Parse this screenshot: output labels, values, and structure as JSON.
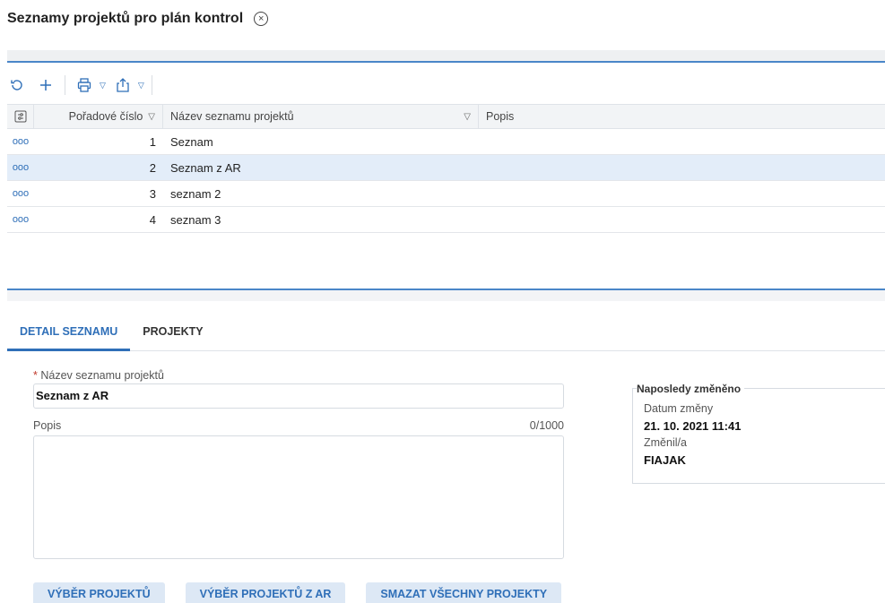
{
  "page": {
    "title": "Seznamy projektů pro plán kontrol",
    "close_icon": "×"
  },
  "grid": {
    "columns": {
      "order": "Pořadové číslo",
      "name": "Název seznamu projektů",
      "description": "Popis"
    },
    "rows": [
      {
        "order": "1",
        "name": "Seznam",
        "description": "",
        "selected": false
      },
      {
        "order": "2",
        "name": "Seznam z AR",
        "description": "",
        "selected": true
      },
      {
        "order": "3",
        "name": "seznam 2",
        "description": "",
        "selected": false
      },
      {
        "order": "4",
        "name": "seznam 3",
        "description": "",
        "selected": false
      }
    ],
    "row_menu_glyph": "ooo"
  },
  "tabs": [
    {
      "label": "DETAIL SEZNAMU",
      "active": true
    },
    {
      "label": "PROJEKTY",
      "active": false
    }
  ],
  "form": {
    "name_required_marker": "*",
    "name_label": "Název seznamu projektů",
    "name_value": "Seznam z AR",
    "description_label": "Popis",
    "description_counter": "0/1000",
    "description_value": ""
  },
  "buttons": {
    "select_projects": "VÝBĚR PROJEKTŮ",
    "select_projects_ar": "VÝBĚR PROJEKTŮ Z AR",
    "delete_all": "SMAZAT VŠECHNY PROJEKTY"
  },
  "last_changed": {
    "title": "Naposledy změněno",
    "date_label": "Datum změny",
    "date_value": "21. 10. 2021 11:41",
    "user_label": "Změnil/a",
    "user_value": "FIAJAK"
  },
  "colors": {
    "accent": "#2f6fb8",
    "selected_row": "#e3edf9"
  }
}
